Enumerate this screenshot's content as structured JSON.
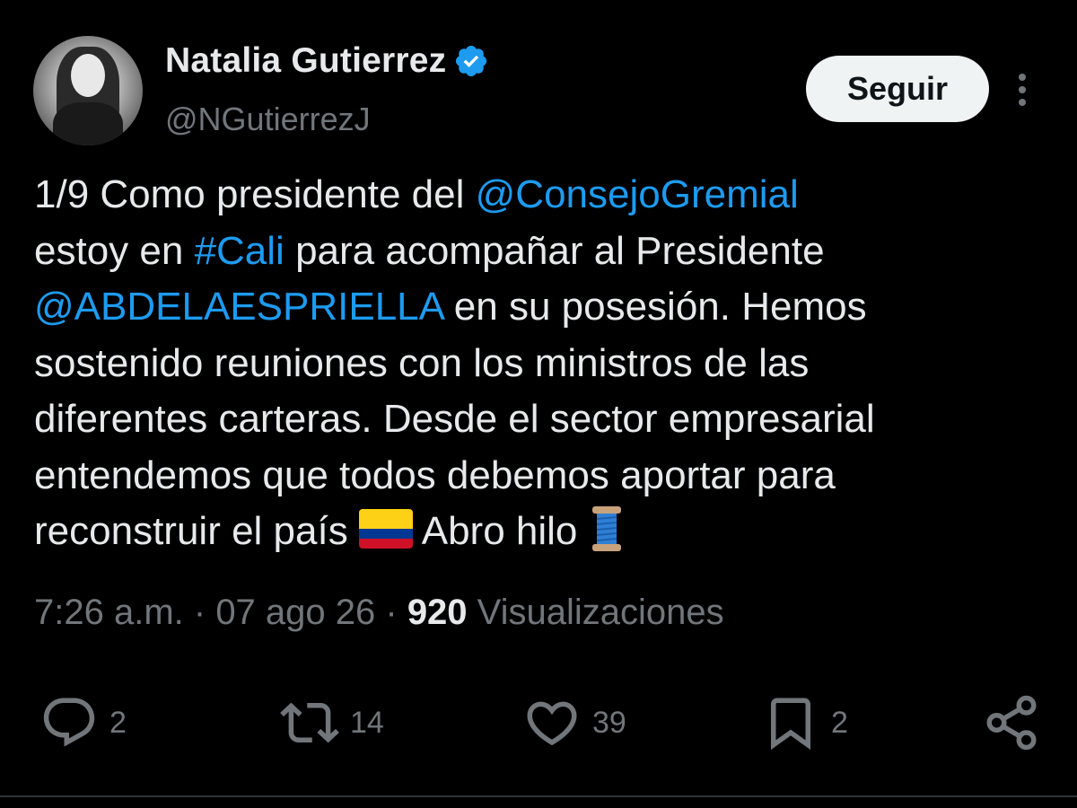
{
  "user": {
    "display_name": "Natalia Gutierrez",
    "handle": "@NGutierrezJ",
    "verified": true
  },
  "follow_button": {
    "label": "Seguir"
  },
  "tweet": {
    "lines": [
      [
        {
          "t": "1/9 Como presidente del "
        },
        {
          "t": "@ConsejoGremial",
          "link": true
        }
      ],
      [
        {
          "t": "estoy en "
        },
        {
          "t": "#Cali",
          "link": true
        },
        {
          "t": " para acompañar al Presidente"
        }
      ],
      [
        {
          "t": "@ABDELAESPRIELLA",
          "link": true
        },
        {
          "t": " en su posesión. Hemos"
        }
      ],
      [
        {
          "t": "sostenido reuniones con los ministros de las"
        }
      ],
      [
        {
          "t": "diferentes carteras. Desde el sector empresarial"
        }
      ],
      [
        {
          "t": "entendemos que todos debemos aportar para"
        }
      ],
      [
        {
          "t": "reconstruir el país "
        },
        {
          "emoji": "colombia-flag"
        },
        {
          "t": " Abro hilo "
        },
        {
          "emoji": "spool-of-thread"
        }
      ]
    ]
  },
  "meta": {
    "time": "7:26 a.m.",
    "separator": " · ",
    "date": "07 ago 26",
    "views_count": "920",
    "views_label": " Visualizaciones"
  },
  "actions": {
    "reply": {
      "icon": "reply-icon",
      "count": "2"
    },
    "repost": {
      "icon": "repost-icon",
      "count": "14"
    },
    "like": {
      "icon": "heart-icon",
      "count": "39"
    },
    "bookmark": {
      "icon": "bookmark-icon",
      "count": "2"
    },
    "share": {
      "icon": "share-icon"
    }
  },
  "colors": {
    "background": "#000000",
    "text": "#e7e9ea",
    "secondary": "#71767b",
    "link": "#1d9bf0",
    "verified": "#1d9bf0"
  }
}
